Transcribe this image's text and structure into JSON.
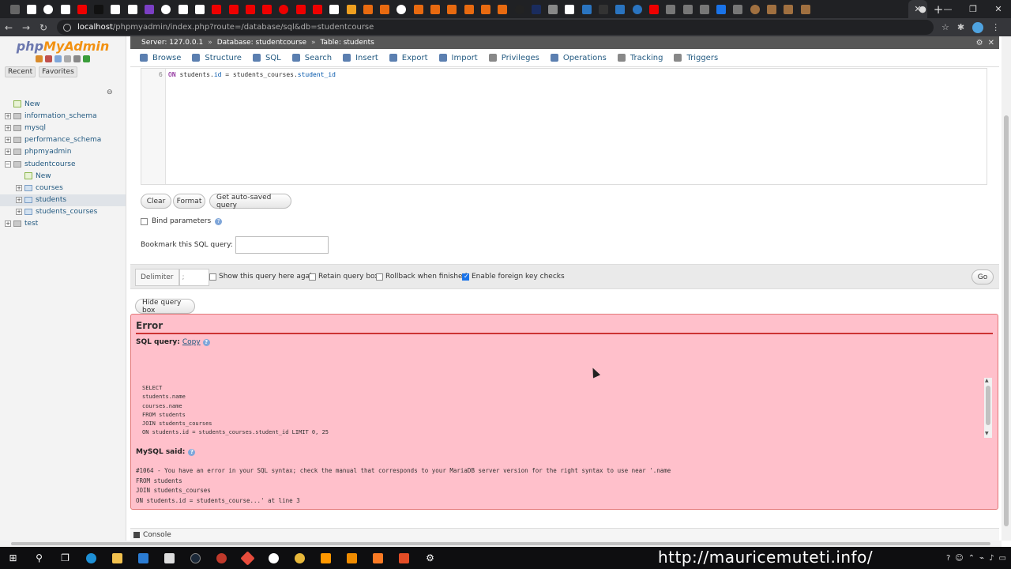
{
  "browser": {
    "url_host": "localhost",
    "url_path": "/phpmyadmin/index.php?route=/database/sql&db=studentcourse",
    "pinned_tab_colors": [
      "#666",
      "#fff",
      "#fff",
      "#fff",
      "#e00",
      "#111",
      "#fff",
      "#fff",
      "#7b3fc4",
      "#fff",
      "#fff",
      "#fff",
      "#e00",
      "#e00",
      "#e00",
      "#e00",
      "#e00",
      "#e00",
      "#e00",
      "#fff",
      "#f0a020",
      "#e86a10",
      "#e86a10",
      "#fff",
      "#e86a10",
      "#e86a10",
      "#e86a10",
      "#e86a10",
      "#e86a10",
      "#e86a10",
      "#222",
      "#1a2c5e",
      "#888",
      "#fff",
      "#2a74c0",
      "#333",
      "#2a74c0",
      "#2a74c0",
      "#e00",
      "#777",
      "#777",
      "#777",
      "#1a73e8",
      "#777",
      "#a07040",
      "#a07040",
      "#a07040",
      "#a07040"
    ]
  },
  "logo": {
    "php": "php",
    "admin": "MyAdmin"
  },
  "nav": {
    "recent_label": "Recent",
    "favorites_label": "Favorites",
    "tree": [
      {
        "label": "New",
        "level": 0,
        "type": "new"
      },
      {
        "label": "information_schema",
        "level": 0,
        "type": "db"
      },
      {
        "label": "mysql",
        "level": 0,
        "type": "db"
      },
      {
        "label": "performance_schema",
        "level": 0,
        "type": "db"
      },
      {
        "label": "phpmyadmin",
        "level": 0,
        "type": "db"
      },
      {
        "label": "studentcourse",
        "level": 0,
        "type": "db",
        "expanded": true
      },
      {
        "label": "New",
        "level": 1,
        "type": "new"
      },
      {
        "label": "courses",
        "level": 1,
        "type": "table"
      },
      {
        "label": "students",
        "level": 1,
        "type": "table",
        "selected": true
      },
      {
        "label": "students_courses",
        "level": 1,
        "type": "table"
      },
      {
        "label": "test",
        "level": 0,
        "type": "db"
      }
    ]
  },
  "breadcrumb": {
    "server": "Server: 127.0.0.1",
    "database": "Database: studentcourse",
    "table": "Table: students"
  },
  "menu": [
    {
      "label": "Browse",
      "color": "#5b7fb0"
    },
    {
      "label": "Structure",
      "color": "#5b7fb0"
    },
    {
      "label": "SQL",
      "color": "#5b7fb0"
    },
    {
      "label": "Search",
      "color": "#5b7fb0"
    },
    {
      "label": "Insert",
      "color": "#5b7fb0"
    },
    {
      "label": "Export",
      "color": "#5b7fb0"
    },
    {
      "label": "Import",
      "color": "#5b7fb0"
    },
    {
      "label": "Privileges",
      "color": "#888"
    },
    {
      "label": "Operations",
      "color": "#5b7fb0"
    },
    {
      "label": "Tracking",
      "color": "#888"
    },
    {
      "label": "Triggers",
      "color": "#888"
    }
  ],
  "editor": {
    "line_number": "6",
    "line_text_kw": "ON",
    "line_text_a": " students.",
    "line_text_col_a": "id",
    "line_text_b": " = students_courses.",
    "line_text_col_b": "student_id"
  },
  "buttons": {
    "clear": "Clear",
    "format": "Format",
    "auto_saved": "Get auto-saved query",
    "go": "Go",
    "hide_query_box": "Hide query box"
  },
  "options": {
    "bind_parameters": "Bind parameters",
    "bookmark_label": "Bookmark this SQL query:",
    "delimiter_label": "Delimiter",
    "delimiter_value": ";",
    "show_query_again": "Show this query here again",
    "retain_query_box": "Retain query box",
    "rollback": "Rollback when finished",
    "foreign_key_checks": "Enable foreign key checks"
  },
  "error": {
    "title": "Error",
    "sql_query_label": "SQL query:",
    "copy_label": "Copy",
    "query_lines": [
      "SELECT",
      "students.name",
      "courses.name",
      "FROM students",
      "JOIN students_courses",
      "ON students.id = students_courses.student_id LIMIT 0, 25"
    ],
    "mysql_said_label": "MySQL said:",
    "message_lines": [
      "#1064 - You have an error in your SQL syntax; check the manual that corresponds to your MariaDB server version for the right syntax to use near '.name",
      "FROM students",
      "JOIN students_courses",
      "ON students.id = students_course...' at line 3"
    ]
  },
  "console_label": "Console",
  "watermark": "http://mauricemuteti.info/"
}
